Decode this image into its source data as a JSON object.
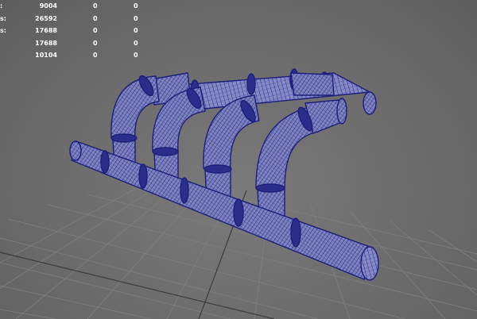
{
  "hud": {
    "rows": [
      {
        "label": ":",
        "c1": "9004",
        "c2": "0",
        "c3": "0"
      },
      {
        "label": "s:",
        "c1": "26592",
        "c2": "0",
        "c3": "0"
      },
      {
        "label": "s:",
        "c1": "17688",
        "c2": "0",
        "c3": "0"
      },
      {
        "label": "",
        "c1": "17688",
        "c2": "0",
        "c3": "0"
      },
      {
        "label": "",
        "c1": "10104",
        "c2": "0",
        "c3": "0"
      }
    ]
  },
  "colors": {
    "background": "#6e6e6e",
    "grid": "#7f7f7f",
    "grid_axis": "#3a3a3a",
    "pipe_fill": "#8b8fc4",
    "pipe_wire": "#1c1f7a",
    "hud_text": "#ffffff"
  }
}
